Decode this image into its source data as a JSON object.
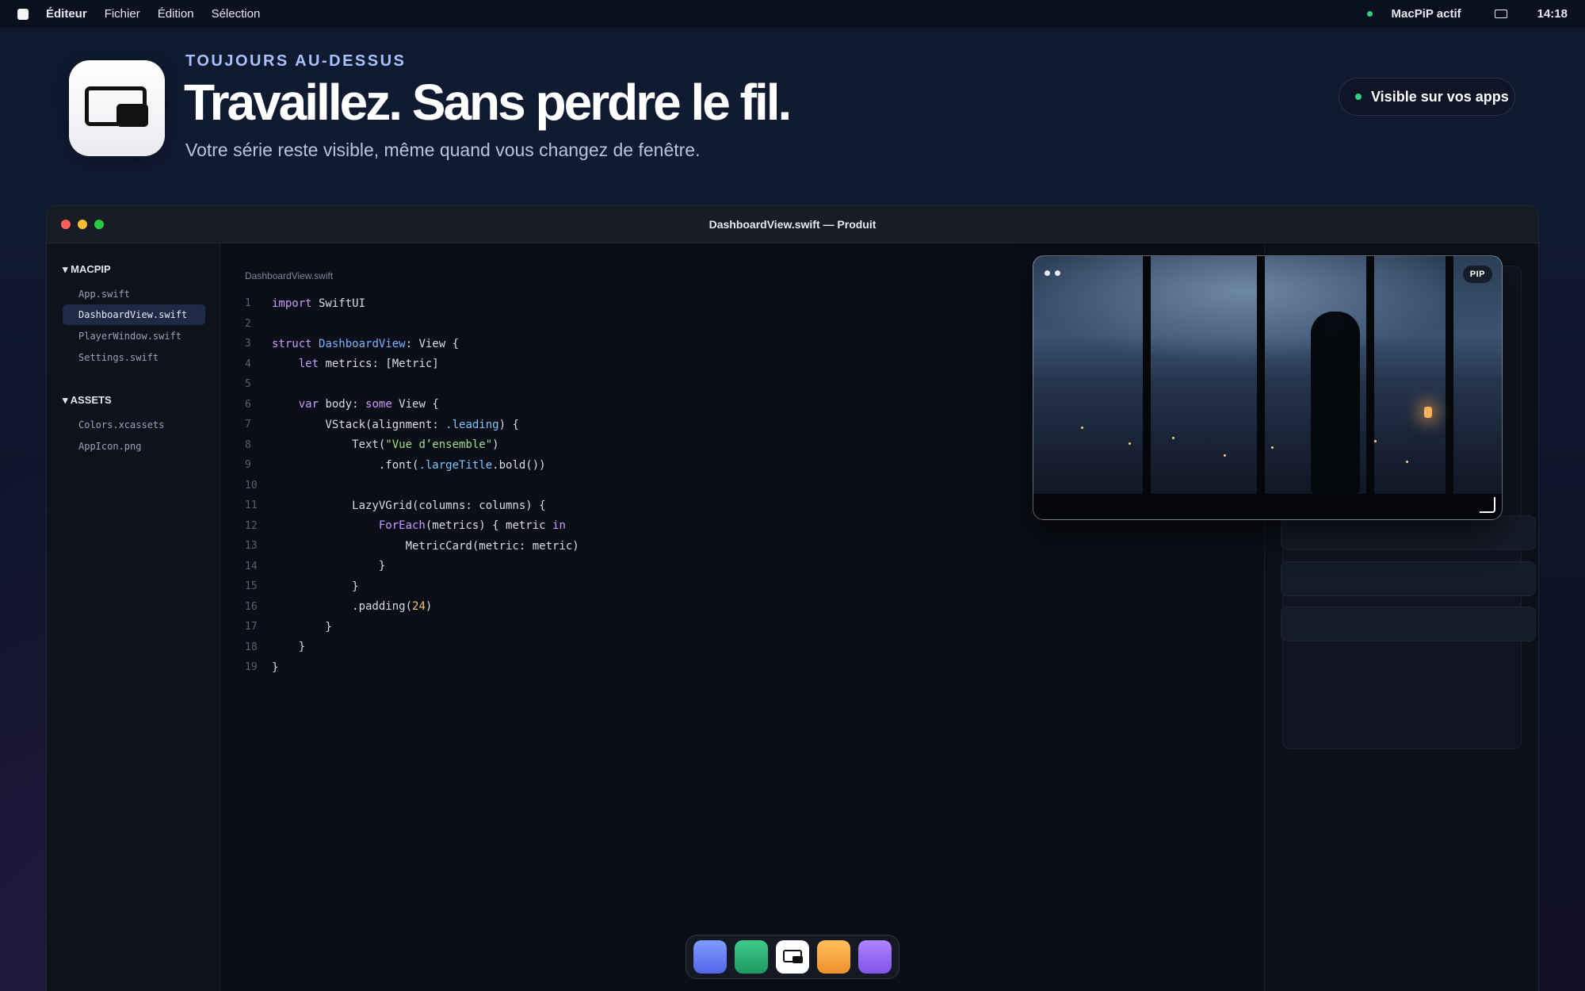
{
  "menubar": {
    "app_name": "Éditeur",
    "menus": [
      "Fichier",
      "Édition",
      "Sélection"
    ],
    "status": "MacPiP actif",
    "clock": "14:18"
  },
  "hero": {
    "eyebrow": "TOUJOURS AU-DESSUS",
    "headline": "Travaillez. Sans perdre le fil.",
    "subline": "Votre série reste visible, même quand vous changez de fenêtre.",
    "badge": "Visible sur vos apps"
  },
  "window": {
    "title": "DashboardView.swift — Produit",
    "breadcrumb": "DashboardView.swift"
  },
  "sidebar": {
    "sections": [
      {
        "label": "MACPIP",
        "items": [
          "App.swift",
          "DashboardView.swift",
          "PlayerWindow.swift",
          "Settings.swift"
        ]
      },
      {
        "label": "ASSETS",
        "items": [
          "Colors.xcassets",
          "AppIcon.png"
        ]
      }
    ],
    "active_item": "DashboardView.swift"
  },
  "code": {
    "line_numbers": [
      "1",
      "2",
      "3",
      "4",
      "5",
      "6",
      "7",
      "8",
      "9",
      "10",
      "11",
      "12",
      "13",
      "14",
      "15",
      "16",
      "17",
      "18",
      "19"
    ],
    "tokens": {
      "l1": [
        "import",
        " SwiftUI"
      ],
      "l3": [
        "struct",
        " ",
        "DashboardView",
        ": View {"
      ],
      "l4": [
        "    ",
        "let",
        " metrics: [Metric]"
      ],
      "l6": [
        "    ",
        "var",
        " body: ",
        "some",
        " View {"
      ],
      "l7": [
        "        VStack(alignment: ",
        ".leading",
        ") {"
      ],
      "l8": [
        "            Text(",
        "\"Vue d’ensemble\"",
        ")"
      ],
      "l9": [
        "                .font(",
        ".largeTitle",
        ".bold())"
      ],
      "l11": [
        "            LazyVGrid(columns: columns) {"
      ],
      "l12": [
        "                ",
        "ForEach",
        "(metrics) { metric ",
        "in"
      ],
      "l13": [
        "                    MetricCard(metric: metric)"
      ],
      "l14": [
        "                }"
      ],
      "l15": [
        "            }"
      ],
      "l16": [
        "            .padding(",
        "24",
        ")"
      ],
      "l17": [
        "        }"
      ],
      "l18": [
        "    }"
      ],
      "l19": [
        "}"
      ]
    }
  },
  "pip": {
    "tag": "PIP"
  },
  "dock": {
    "apps": [
      "blue-app-icon",
      "green-app-icon",
      "macpip-app-icon",
      "orange-app-icon",
      "purple-app-icon"
    ]
  },
  "colors": {
    "accent_eyebrow": "#a9c0ff",
    "status_green": "#2fd27a",
    "keyword": "#c79bff",
    "type": "#7fb2ff",
    "string": "#9ddf8a",
    "number": "#f3c86b"
  }
}
